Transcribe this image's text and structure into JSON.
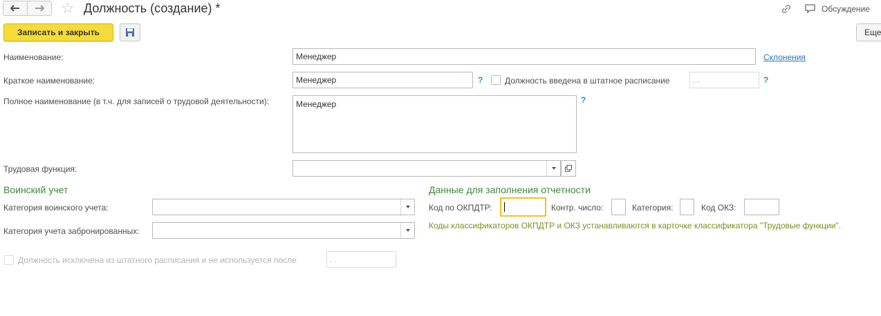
{
  "header": {
    "title": "Должность (создание) *",
    "discussion_label": "Обсуждение"
  },
  "toolbar": {
    "save_close_label": "Записать и закрыть",
    "more_label": "Еще"
  },
  "form": {
    "name_label": "Наименование:",
    "name_value": "Менеджер",
    "declensions_link": "Склонения",
    "short_name_label": "Краткое наименование:",
    "short_name_value": "Менеджер",
    "help_mark": "?",
    "in_staff_label": "Должность введена в штатное расписание",
    "in_staff_date": " .  .",
    "full_name_label": "Полное наименование (в т.ч. для записей о трудовой деятельности):",
    "full_name_value": "Менеджер",
    "labor_function_label": "Трудовая функция:",
    "labor_function_value": ""
  },
  "military": {
    "section_title": "Воинский учет",
    "category_label": "Категория воинского учета:",
    "category_value": "",
    "reserved_label": "Категория учета забронированных:",
    "reserved_value": ""
  },
  "reporting": {
    "section_title": "Данные для заполнения отчетности",
    "okpdtr_label": "Код по ОКПДТР:",
    "okpdtr_value": "",
    "check_number_label": "Контр. число:",
    "check_number_value": "",
    "category_label": "Категория:",
    "category_value": "",
    "okz_label": "Код ОКЗ:",
    "okz_value": "",
    "note": "Коды классификаторов ОКПДТР и ОКЗ устанавливаются в карточке классификатора \"Трудовые функции\"."
  },
  "excluded": {
    "label": "Должность исключена из штатного расписания и не используется после",
    "date": " .  ."
  },
  "colors": {
    "accent_yellow": "#f5dc3a",
    "section_green": "#3c8a3c",
    "note_olive": "#7c8e1f",
    "link_blue": "#2b73b8",
    "help_blue": "#2e8bc2"
  },
  "icons": [
    "arrow-left-icon",
    "arrow-right-icon",
    "star-icon",
    "link-icon",
    "discussion-icon",
    "floppy-disk-icon",
    "chevron-down-icon",
    "open-form-icon"
  ]
}
